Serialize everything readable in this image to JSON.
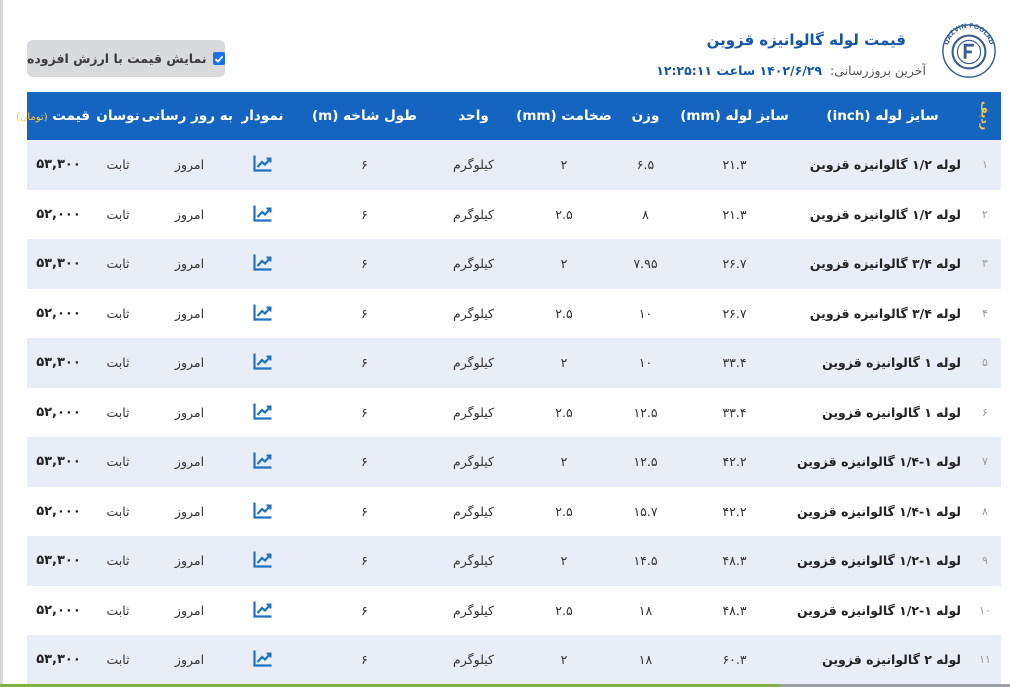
{
  "header": {
    "title": "قیمت لوله گالوانیزه قزوین",
    "last_update_label": "آخرین بروزرسانی:",
    "last_update_value": "۱۴۰۲/۶/۲۹ ساعت ۱۲:۲۵:۱۱",
    "logo_text": "QAZVIN FOOLAD CO"
  },
  "vat_toggle": {
    "label": "نمایش قیمت با ارزش افزوده",
    "checked": true
  },
  "table": {
    "headers": {
      "row": "ردیف",
      "size_inch": "سایز لوله (inch)",
      "size_mm": "سایز لوله (mm)",
      "weight": "وزن",
      "thickness": "ضخامت (mm)",
      "unit": "واحد",
      "length": "طول شاخه (m)",
      "chart": "نمودار",
      "updated": "به روز رسانی",
      "fluctuation": "نوسان",
      "price": "قیمت",
      "price_unit": "(تومان)"
    },
    "rows": [
      {
        "n": "۱",
        "name": "لوله ۱/۲ گالوانیزه قزوین",
        "mm": "۲۱.۳",
        "weight": "۶.۵",
        "thickness": "۲",
        "unit": "کیلوگرم",
        "length": "۶",
        "updated": "امروز",
        "fluctuation": "ثابت",
        "price": "۵۳,۳۰۰"
      },
      {
        "n": "۲",
        "name": "لوله ۱/۲ گالوانیزه قزوین",
        "mm": "۲۱.۳",
        "weight": "۸",
        "thickness": "۲.۵",
        "unit": "کیلوگرم",
        "length": "۶",
        "updated": "امروز",
        "fluctuation": "ثابت",
        "price": "۵۲,۰۰۰"
      },
      {
        "n": "۳",
        "name": "لوله ۳/۴ گالوانیزه قزوین",
        "mm": "۲۶.۷",
        "weight": "۷.۹۵",
        "thickness": "۲",
        "unit": "کیلوگرم",
        "length": "۶",
        "updated": "امروز",
        "fluctuation": "ثابت",
        "price": "۵۳,۳۰۰"
      },
      {
        "n": "۴",
        "name": "لوله ۳/۴ گالوانیزه قزوین",
        "mm": "۲۶.۷",
        "weight": "۱۰",
        "thickness": "۲.۵",
        "unit": "کیلوگرم",
        "length": "۶",
        "updated": "امروز",
        "fluctuation": "ثابت",
        "price": "۵۲,۰۰۰"
      },
      {
        "n": "۵",
        "name": "لوله ۱ گالوانیزه قزوین",
        "mm": "۳۳.۴",
        "weight": "۱۰",
        "thickness": "۲",
        "unit": "کیلوگرم",
        "length": "۶",
        "updated": "امروز",
        "fluctuation": "ثابت",
        "price": "۵۳,۳۰۰"
      },
      {
        "n": "۶",
        "name": "لوله ۱ گالوانیزه قزوین",
        "mm": "۳۳.۴",
        "weight": "۱۲.۵",
        "thickness": "۲.۵",
        "unit": "کیلوگرم",
        "length": "۶",
        "updated": "امروز",
        "fluctuation": "ثابت",
        "price": "۵۲,۰۰۰"
      },
      {
        "n": "۷",
        "name": "لوله ۱-۱/۴ گالوانیزه قزوین",
        "mm": "۴۲.۲",
        "weight": "۱۲.۵",
        "thickness": "۲",
        "unit": "کیلوگرم",
        "length": "۶",
        "updated": "امروز",
        "fluctuation": "ثابت",
        "price": "۵۳,۳۰۰"
      },
      {
        "n": "۸",
        "name": "لوله ۱-۱/۴ گالوانیزه قزوین",
        "mm": "۴۲.۲",
        "weight": "۱۵.۷",
        "thickness": "۲.۵",
        "unit": "کیلوگرم",
        "length": "۶",
        "updated": "امروز",
        "fluctuation": "ثابت",
        "price": "۵۲,۰۰۰"
      },
      {
        "n": "۹",
        "name": "لوله ۱-۱/۲ گالوانیزه قزوین",
        "mm": "۴۸.۳",
        "weight": "۱۴.۵",
        "thickness": "۲",
        "unit": "کیلوگرم",
        "length": "۶",
        "updated": "امروز",
        "fluctuation": "ثابت",
        "price": "۵۳,۳۰۰"
      },
      {
        "n": "۱۰",
        "name": "لوله ۱-۱/۲ گالوانیزه قزوین",
        "mm": "۴۸.۳",
        "weight": "۱۸",
        "thickness": "۲.۵",
        "unit": "کیلوگرم",
        "length": "۶",
        "updated": "امروز",
        "fluctuation": "ثابت",
        "price": "۵۲,۰۰۰"
      },
      {
        "n": "۱۱",
        "name": "لوله ۲ گالوانیزه قزوین",
        "mm": "۶۰.۳",
        "weight": "۱۸",
        "thickness": "۲",
        "unit": "کیلوگرم",
        "length": "۶",
        "updated": "امروز",
        "fluctuation": "ثابت",
        "price": "۵۳,۳۰۰"
      }
    ]
  },
  "colors": {
    "header_bg": "#1565c0",
    "accent": "#1456a8",
    "row_alt": "#e9edf7",
    "unit_label": "#f7c948"
  },
  "icons": {
    "chart": "chart-line-up-icon",
    "checkbox": "checkbox-checked-icon",
    "logo": "company-logo-icon"
  }
}
